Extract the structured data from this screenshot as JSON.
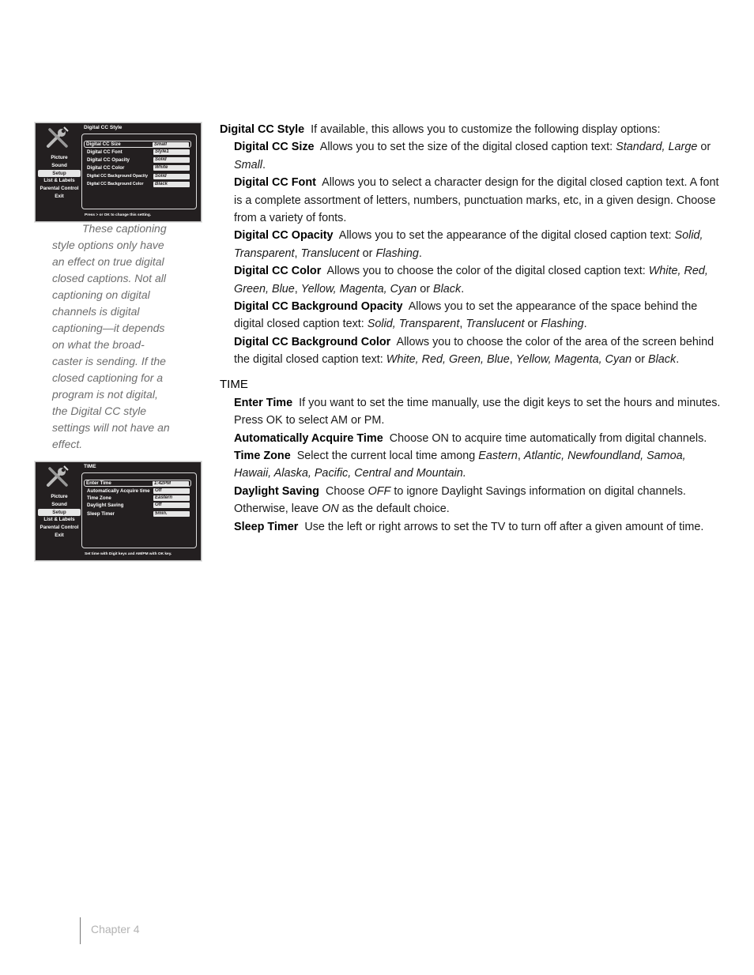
{
  "screenshot_cc": {
    "title": "Digital CC Style",
    "sidebar": [
      "Picture",
      "Sound",
      "Setup",
      "List & Labels",
      "Parental Control",
      "Exit"
    ],
    "active_sidebar": "Setup",
    "rows": [
      {
        "label": "Digital CC Size",
        "value": "Small",
        "selected": true
      },
      {
        "label": "Digital CC Font",
        "value": "Style1"
      },
      {
        "label": "Digital CC Opacity",
        "value": "Solid"
      },
      {
        "label": "Digital CC Color",
        "value": "White"
      },
      {
        "label": "Digital CC Background Opacity",
        "value": "Solid"
      },
      {
        "label": "Digital CC Background Color",
        "value": "Black"
      }
    ],
    "hint": "Press > or OK to change this setting."
  },
  "screenshot_time": {
    "title": "TIME",
    "sidebar": [
      "Picture",
      "Sound",
      "Setup",
      "List & Labels",
      "Parental Control",
      "Exit"
    ],
    "active_sidebar": "Setup",
    "rows": [
      {
        "label": "Enter Time",
        "value": "1:42PM",
        "selected": true
      },
      {
        "label": "Automatically Acquire time",
        "value": "Off"
      },
      {
        "label": "Time Zone",
        "value": "Eastern"
      },
      {
        "label": "Daylight Saving",
        "value": "Off"
      },
      {
        "label": "Sleep Timer",
        "value": "5min."
      }
    ],
    "hint": "Set time with Digit keys and AM/PM with OK key."
  },
  "sidenote": "These captioning style options only have an effect on true digital closed captions. Not all captioning on digital channels is digital captioning—it depends on what the broad-caster is sending. If the closed captioning for a program is not digital, the Digital CC style settings will not have an effect.",
  "main": {
    "cc_style": {
      "term": "Digital CC Style",
      "text": "If available, this allows you to customize the following display options:"
    },
    "cc_items": [
      {
        "term": "Digital CC Size",
        "parts": [
          [
            "t",
            "Allows you to set the size of the digital closed caption text: "
          ],
          [
            "i",
            "Standard, Large"
          ],
          [
            "t",
            " or "
          ],
          [
            "i",
            "Small"
          ],
          [
            "t",
            "."
          ]
        ]
      },
      {
        "term": "Digital CC Font",
        "parts": [
          [
            "t",
            "Allows you to select a character design for the digital closed caption text. A font is a complete assortment of letters, numbers, punctuation marks, etc, in a given design. Choose from a variety of fonts."
          ]
        ]
      },
      {
        "term": "Digital CC Opacity",
        "parts": [
          [
            "t",
            "Allows you to set the appearance of the digital closed caption text: "
          ],
          [
            "i",
            "Solid, Transparent"
          ],
          [
            "t",
            ", "
          ],
          [
            "i",
            "Translucent"
          ],
          [
            "t",
            " or "
          ],
          [
            "i",
            "Flashing"
          ],
          [
            "t",
            "."
          ]
        ]
      },
      {
        "term": "Digital CC Color",
        "parts": [
          [
            "t",
            "Allows you to choose the color of  the digital closed caption text: "
          ],
          [
            "i",
            "White, Red, Green, Blue"
          ],
          [
            "t",
            ", "
          ],
          [
            "i",
            "Yellow, Magenta, Cyan"
          ],
          [
            "t",
            " or "
          ],
          [
            "i",
            "Black"
          ],
          [
            "t",
            "."
          ]
        ]
      },
      {
        "term": "Digital CC Background Opacity",
        "parts": [
          [
            "t",
            "Allows you to set the appearance of the space behind the digital closed caption text: "
          ],
          [
            "i",
            "Solid, Transparent"
          ],
          [
            "t",
            ", "
          ],
          [
            "i",
            "Translucent"
          ],
          [
            "t",
            " or "
          ],
          [
            "i",
            "Flashing"
          ],
          [
            "t",
            "."
          ]
        ]
      },
      {
        "term": "Digital CC Background Color",
        "parts": [
          [
            "t",
            "Allows you to choose the color of the area of the screen behind the digital closed caption text: "
          ],
          [
            "i",
            "White, Red, Green, Blue"
          ],
          [
            "t",
            ", "
          ],
          [
            "i",
            "Yellow, Magenta, Cyan"
          ],
          [
            "t",
            " or "
          ],
          [
            "i",
            "Black"
          ],
          [
            "t",
            "."
          ]
        ]
      }
    ],
    "time_heading": "TIME",
    "time_items": [
      {
        "term": "Enter Time",
        "parts": [
          [
            "t",
            "If you want to set the time manually, use the digit keys to set the hours and minutes. Press OK to select AM or PM."
          ]
        ]
      },
      {
        "term": "Automatically Acquire Time",
        "parts": [
          [
            "t",
            "Choose ON to acquire time automatically from digital channels."
          ]
        ]
      },
      {
        "term": "Time Zone",
        "parts": [
          [
            "t",
            "Select the current local time among "
          ],
          [
            "i",
            "Eastern"
          ],
          [
            "t",
            ", "
          ],
          [
            "i",
            "Atlantic, Newfoundland, Samoa, Hawaii, Alaska, Pacific, Central and Mountain."
          ]
        ]
      },
      {
        "term": "Daylight Saving",
        "parts": [
          [
            "t",
            "Choose "
          ],
          [
            "i",
            "OFF"
          ],
          [
            "t",
            " to ignore Daylight Savings information on digital channels. Otherwise, leave "
          ],
          [
            "i",
            "ON"
          ],
          [
            "t",
            " as the default choice."
          ]
        ]
      },
      {
        "term": "Sleep Timer",
        "parts": [
          [
            "t",
            "Use the left or right arrows to set the TV to turn off after a given amount of time."
          ]
        ]
      }
    ]
  },
  "footer": {
    "chapter": "Chapter 4"
  }
}
